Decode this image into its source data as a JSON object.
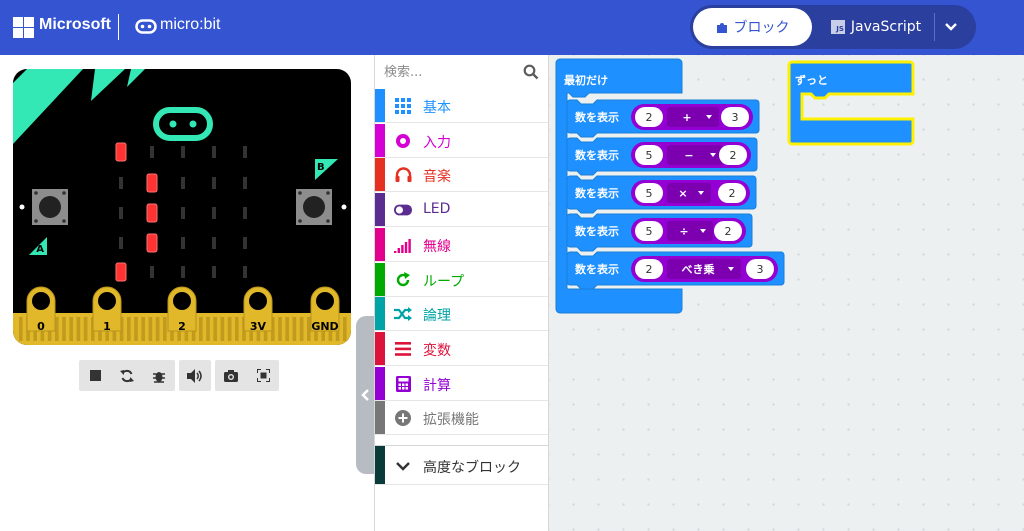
{
  "header": {
    "brand": "Microsoft",
    "product": "micro:bit",
    "tabs": {
      "blocks": "ブロック",
      "javascript": "JavaScript",
      "js_badge": "JS"
    },
    "colors": {
      "bar": "#3454d1",
      "toggle": "#2a3f9e"
    }
  },
  "simulator": {
    "buttons": {
      "a": "A",
      "b": "B"
    },
    "pins": [
      "0",
      "1",
      "2",
      "3V",
      "GND"
    ],
    "led_matrix": [
      [
        1,
        0,
        0,
        0,
        0
      ],
      [
        0,
        1,
        0,
        0,
        0
      ],
      [
        0,
        1,
        0,
        0,
        0
      ],
      [
        0,
        1,
        0,
        0,
        0
      ],
      [
        1,
        0,
        0,
        0,
        0
      ]
    ],
    "toolbar_icons": [
      "stop-icon",
      "restart-icon",
      "debug-icon",
      "sound-icon",
      "screenshot-icon",
      "fullscreen-icon"
    ]
  },
  "toolbox": {
    "search_placeholder": "検索...",
    "categories": [
      {
        "label": "基本",
        "color": "#1e90ff",
        "icon": "grid-icon"
      },
      {
        "label": "入力",
        "color": "#d400d4",
        "icon": "target-icon"
      },
      {
        "label": "音楽",
        "color": "#e63022",
        "icon": "headphones-icon"
      },
      {
        "label": "LED",
        "color": "#5c2d91",
        "icon": "toggle-icon"
      },
      {
        "label": "無線",
        "color": "#e3008c",
        "icon": "signal-icon"
      },
      {
        "label": "ループ",
        "color": "#00aa00",
        "icon": "loop-icon"
      },
      {
        "label": "論理",
        "color": "#00a4a6",
        "icon": "shuffle-icon"
      },
      {
        "label": "変数",
        "color": "#dc143c",
        "icon": "lines-icon"
      },
      {
        "label": "計算",
        "color": "#9400d3",
        "icon": "calculator-icon"
      },
      {
        "label": "拡張機能",
        "color": "#777777",
        "icon": "plus-circle-icon"
      }
    ],
    "advanced": {
      "label": "高度なブロック",
      "color": "#0b3a3a"
    }
  },
  "workspace": {
    "on_start": {
      "label": "最初だけ",
      "statements": [
        {
          "label": "数を表示",
          "left": "2",
          "op": "+",
          "right": "3"
        },
        {
          "label": "数を表示",
          "left": "5",
          "op": "−",
          "right": "2"
        },
        {
          "label": "数を表示",
          "left": "5",
          "op": "×",
          "right": "2"
        },
        {
          "label": "数を表示",
          "left": "5",
          "op": "÷",
          "right": "2"
        },
        {
          "label": "数を表示",
          "left": "2",
          "op": "べき乗",
          "right": "3"
        }
      ]
    },
    "forever": {
      "label": "ずっと"
    },
    "colors": {
      "basic": "#1e90ff",
      "math": "#9400d3",
      "forever_outline": "#ffef00"
    }
  }
}
